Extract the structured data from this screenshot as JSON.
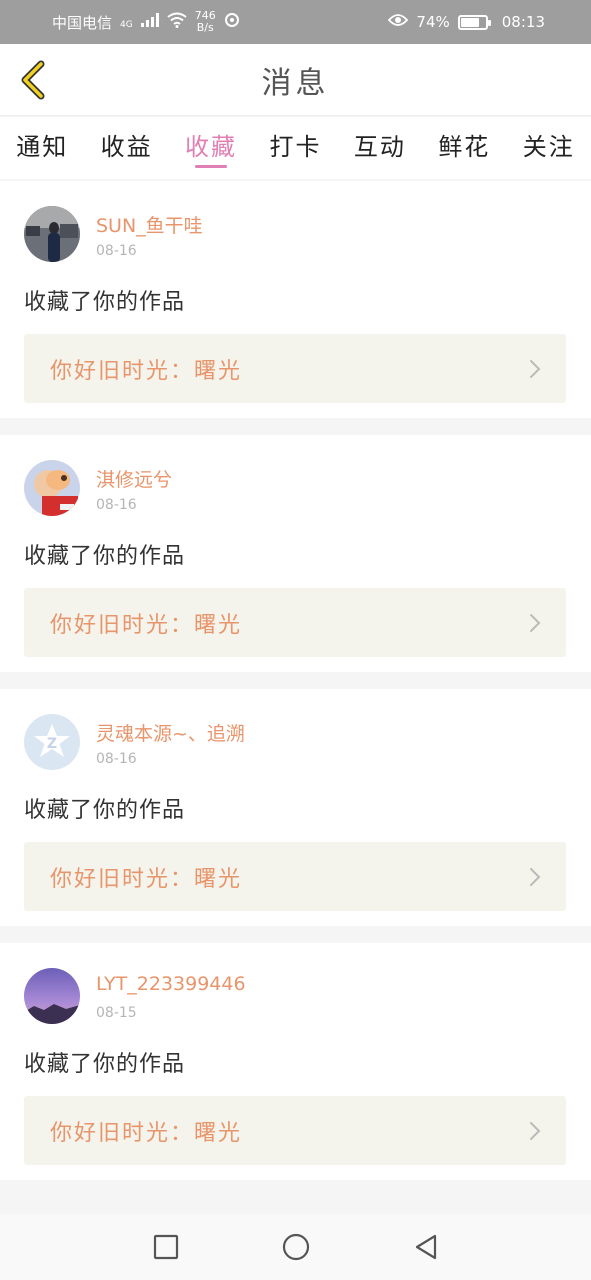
{
  "status_bar": {
    "carrier": "中国电信",
    "network": "4G",
    "speed_value": "746",
    "speed_unit": "B/s",
    "battery": "74%",
    "time": "08:13"
  },
  "header": {
    "title": "消息",
    "back_icon": "chevron-left-icon"
  },
  "tabs": [
    {
      "label": "通知",
      "active": false
    },
    {
      "label": "收益",
      "active": false
    },
    {
      "label": "收藏",
      "active": true
    },
    {
      "label": "打卡",
      "active": false
    },
    {
      "label": "互动",
      "active": false
    },
    {
      "label": "鲜花",
      "active": false
    },
    {
      "label": "关注",
      "active": false
    }
  ],
  "messages": [
    {
      "username": "SUN_鱼干哇",
      "date": "08-16",
      "action": "收藏了你的作品",
      "work": "你好旧时光：曙光"
    },
    {
      "username": "淇修远兮",
      "date": "08-16",
      "action": "收藏了你的作品",
      "work": "你好旧时光：曙光"
    },
    {
      "username": "灵魂本源~、追溯",
      "date": "08-16",
      "action": "收藏了你的作品",
      "work": "你好旧时光：曙光"
    },
    {
      "username": "LYT_223399446",
      "date": "08-15",
      "action": "收藏了你的作品",
      "work": "你好旧时光：曙光"
    }
  ],
  "colors": {
    "accent": "#e07fb3",
    "username": "#e8956b",
    "work_bg": "#f4f4ec",
    "back_icon": "#f0d020"
  }
}
